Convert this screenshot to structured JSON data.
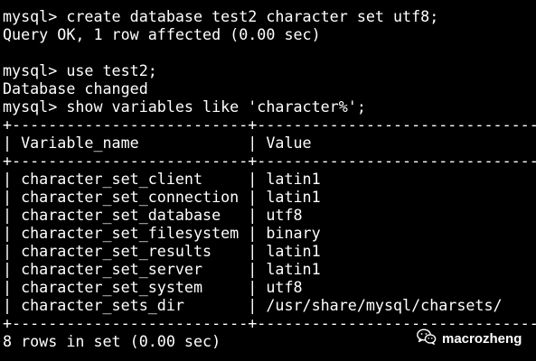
{
  "terminal": {
    "lines": [
      "mysql> create database test2 character set utf8;",
      "Query OK, 1 row affected (0.00 sec)",
      "",
      "mysql> use test2;",
      "Database changed",
      "mysql> show variables like 'character%';",
      "+--------------------------+--------------------------------+",
      "| Variable_name            | Value                          |",
      "+--------------------------+--------------------------------+",
      "| character_set_client     | latin1                         |",
      "| character_set_connection | latin1                         |",
      "| character_set_database   | utf8                           |",
      "| character_set_filesystem | binary                         |",
      "| character_set_results    | latin1                         |",
      "| character_set_server     | latin1                         |",
      "| character_set_system     | utf8                           |",
      "| character_sets_dir       | /usr/share/mysql/charsets/     |",
      "+--------------------------+--------------------------------+",
      "8 rows in set (0.00 sec)"
    ]
  },
  "watermark": {
    "text": "macrozheng",
    "icon": "wechat-icon"
  },
  "colors": {
    "background": "#000000",
    "foreground": "#ffffff"
  }
}
